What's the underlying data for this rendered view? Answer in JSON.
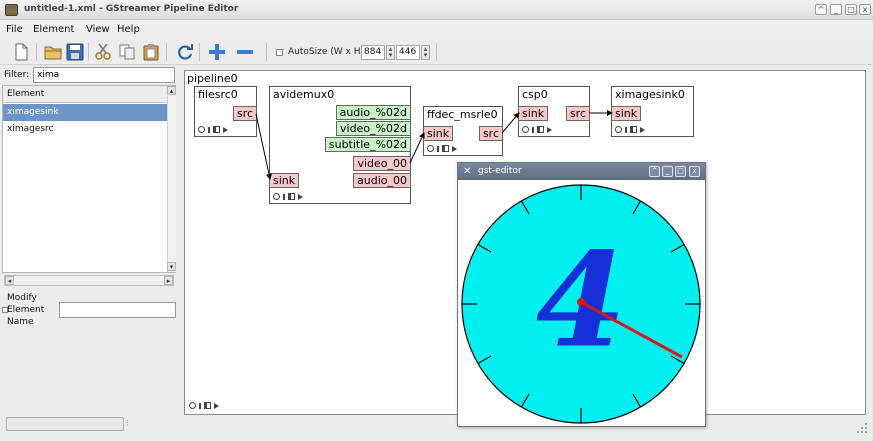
{
  "window": {
    "title": "untitled-1.xml - GStreamer Pipeline Editor",
    "controls": [
      "^",
      "_",
      "□",
      "x"
    ]
  },
  "menu": [
    "File",
    "Element",
    "View",
    "Help"
  ],
  "toolbar": {
    "autosize_label": "AutoSize (W x H)",
    "width_value": "884",
    "height_value": "446"
  },
  "filter": {
    "label": "Filter:",
    "value": "xima"
  },
  "element_list": {
    "header": "Element",
    "items": [
      {
        "label": "ximagesink",
        "selected": true
      },
      {
        "label": "ximagesrc",
        "selected": false
      }
    ]
  },
  "properties": {
    "modify_label": "Modify",
    "element_label": "Element",
    "name_label": "Name",
    "name_value": ""
  },
  "canvas": {
    "pipeline_label": "pipeline0",
    "elements": [
      {
        "name": "filesrc0",
        "pads": [
          {
            "label": "src",
            "kind": "src"
          }
        ]
      },
      {
        "name": "avidemux0",
        "pads": [
          {
            "label": "audio_%02d",
            "kind": "template"
          },
          {
            "label": "video_%02d",
            "kind": "template"
          },
          {
            "label": "subtitle_%02d",
            "kind": "template"
          },
          {
            "label": "video_00",
            "kind": "src"
          },
          {
            "label": "audio_00",
            "kind": "src"
          },
          {
            "label": "sink",
            "kind": "sink"
          }
        ]
      },
      {
        "name": "ffdec_msrle0",
        "pads": [
          {
            "label": "sink",
            "kind": "sink"
          },
          {
            "label": "src",
            "kind": "src"
          }
        ]
      },
      {
        "name": "csp0",
        "pads": [
          {
            "label": "sink",
            "kind": "sink"
          },
          {
            "label": "src",
            "kind": "src"
          }
        ]
      },
      {
        "name": "ximagesink0",
        "pads": [
          {
            "label": "sink",
            "kind": "sink"
          }
        ]
      }
    ],
    "colors": {
      "pad_src_sink": "#f9c9c9",
      "pad_template": "#c9f2c9"
    }
  },
  "popup": {
    "title": "gst-editor",
    "controls": [
      "^",
      "_",
      "□",
      "x"
    ],
    "clock": {
      "face_color": "#00f0f0",
      "digit": "4",
      "digit_color": "#1430d8",
      "hand_color": "#d81818"
    }
  }
}
